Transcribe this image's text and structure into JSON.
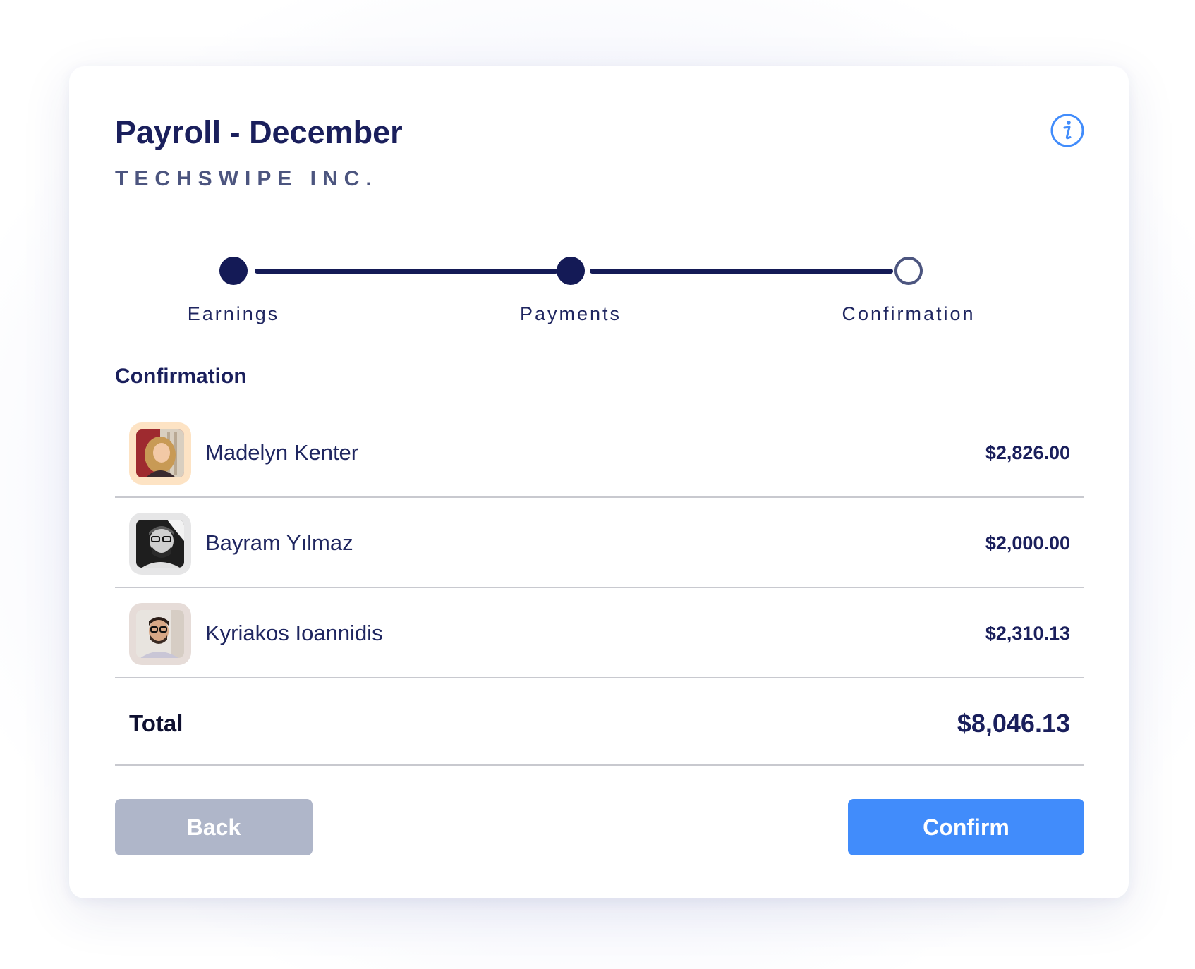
{
  "header": {
    "title": "Payroll - December",
    "company": "TECHSWIPE INC.",
    "info_icon": "info-icon"
  },
  "stepper": {
    "steps": [
      {
        "label": "Earnings",
        "state": "completed"
      },
      {
        "label": "Payments",
        "state": "completed"
      },
      {
        "label": "Confirmation",
        "state": "pending"
      }
    ]
  },
  "confirmation": {
    "section_title": "Confirmation",
    "rows": [
      {
        "name": "Madelyn Kenter",
        "amount": "$2,826.00",
        "avatar": "avatar-photo"
      },
      {
        "name": "Bayram Yılmaz",
        "amount": "$2,000.00",
        "avatar": "avatar-photo"
      },
      {
        "name": "Kyriakos Ioannidis",
        "amount": "$2,310.13",
        "avatar": "avatar-photo"
      }
    ],
    "total_label": "Total",
    "total_value": "$8,046.13"
  },
  "actions": {
    "back_label": "Back",
    "confirm_label": "Confirm"
  },
  "colors": {
    "navy": "#141a56",
    "accent_blue": "#418cfb",
    "back_gray": "#afb6c9",
    "divider": "#c8c9cf"
  }
}
